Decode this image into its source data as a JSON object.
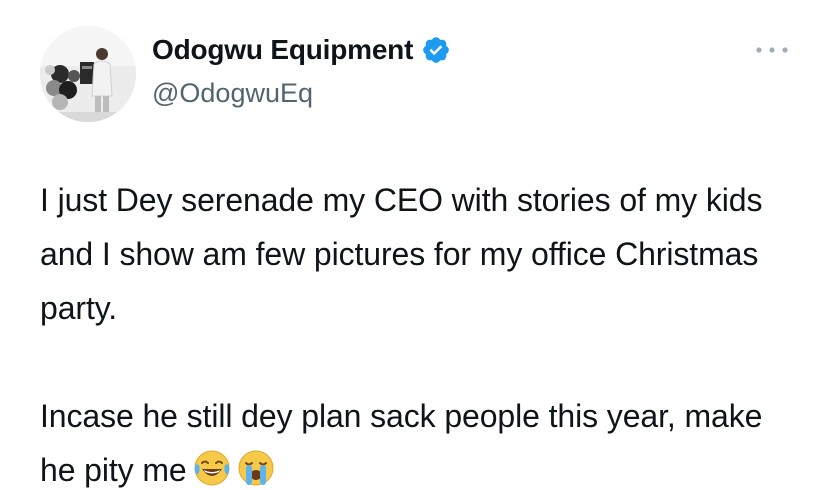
{
  "author": {
    "display_name": "Odogwu Equipment",
    "handle": "@OdogwuEq",
    "verified": true,
    "verified_icon": "verified-badge-icon"
  },
  "menu": {
    "icon": "more-options-icon"
  },
  "tweet": {
    "paragraph_1": "I just Dey serenade my CEO with stories of my kids and I show am few pictures for my office Christmas party.",
    "paragraph_2": "Incase he still dey plan sack people this year, make he pity me",
    "emojis": [
      "face-with-tears-of-joy",
      "loudly-crying-face"
    ]
  },
  "colors": {
    "text": "#0f1419",
    "secondary_text": "#536471",
    "verified_blue": "#1d9bf0",
    "background": "#ffffff"
  }
}
